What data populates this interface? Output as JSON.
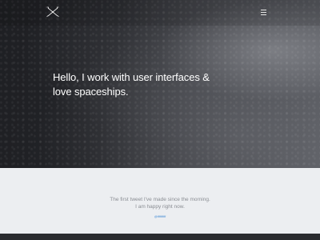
{
  "hero": {
    "tagline": "Hello, I work with user interfaces & love spaceships."
  },
  "nav": {
    "logo_icon": "crossed-arrows-logo",
    "menu_icon": "hamburger-menu-icon"
  },
  "tweet": {
    "line1": "The first tweet I've made since the morning.",
    "line2": "I am happy right now.",
    "handle": "@ffffffffff"
  },
  "colors": {
    "hero_dark": "#1e1f23",
    "tweet_bg": "#eceef1",
    "tweet_text": "#8a8d93",
    "link": "#4a8fd6"
  }
}
